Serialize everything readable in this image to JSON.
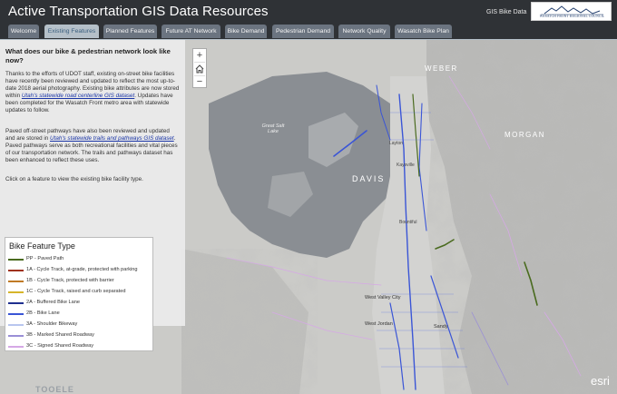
{
  "header": {
    "title": "Active Transportation GIS Data Resources",
    "subtitle": "GIS Bike Data",
    "logo_text": "WASATCH FRONT REGIONAL COUNCIL"
  },
  "tabs": [
    {
      "label": "Welcome",
      "active": false
    },
    {
      "label": "Existing Features",
      "active": true
    },
    {
      "label": "Planned Features",
      "active": false
    },
    {
      "label": "Future AT Network",
      "active": false
    },
    {
      "label": "Bike Demand",
      "active": false
    },
    {
      "label": "Pedestrian Demand",
      "active": false
    },
    {
      "label": "Network Quality",
      "active": false
    },
    {
      "label": "Wasatch Bike Plan",
      "active": false
    }
  ],
  "panel": {
    "heading": "What does our bike & pedestrian network look like now?",
    "para1_pre": "Thanks to the efforts of UDOT staff, existing on-street bike facilities have recently been reviewed and updated to reflect the most up-to-date 2018 aerial photography. Existing bike attributes are now stored within ",
    "para1_link": "Utah's statewide road centerline GIS dataset",
    "para1_post": ". Updates have been completed for the Wasatch Front metro area with statewide updates to follow.",
    "para2_pre": "Paved off-street pathways have also been reviewed and updated and are stored in ",
    "para2_link": "Utah's statewide trails and pathways GIS dataset",
    "para2_post": ". Paved pathways serve as both recreational facilities and vital pieces of our transportation network. The trails and pathways dataset has been enhanced to reflect these uses.",
    "para3": "Click on a feature to view the existing bike facility type."
  },
  "legend": {
    "title": "Bike Feature Type",
    "items": [
      {
        "label": "PP - Paved Path",
        "color": "#4a6b1f"
      },
      {
        "label": "1A - Cycle Track, at-grade, protected with parking",
        "color": "#a0321e"
      },
      {
        "label": "1B - Cycle Track, protected with barrier",
        "color": "#c07a25"
      },
      {
        "label": "1C - Cycle Track, raised and curb separated",
        "color": "#d6b52a"
      },
      {
        "label": "2A - Buffered Bike Lane",
        "color": "#1f2f8f"
      },
      {
        "label": "2B - Bike Lane",
        "color": "#3a55d6"
      },
      {
        "label": "3A - Shoulder Bikeway",
        "color": "#b9c6ef"
      },
      {
        "label": "3B - Marked Shared Roadway",
        "color": "#9a8fd6"
      },
      {
        "label": "3C - Signed Shared Roadway",
        "color": "#d6a8e6"
      }
    ]
  },
  "map": {
    "zoom_in": "+",
    "zoom_out": "−",
    "home_icon": "home-icon",
    "labels": {
      "weber": "WEBER",
      "morgan": "MORGAN",
      "davis": "DAVIS",
      "great_salt_lake": "Great Salt Lake",
      "layton": "Layton",
      "kaysville": "Kaysville",
      "bountiful": "Bountiful",
      "west_valley": "West Valley City",
      "west_jordan": "West Jordan",
      "sandy": "Sandy",
      "tooele": "TOOELE"
    },
    "attribution": "esri"
  }
}
